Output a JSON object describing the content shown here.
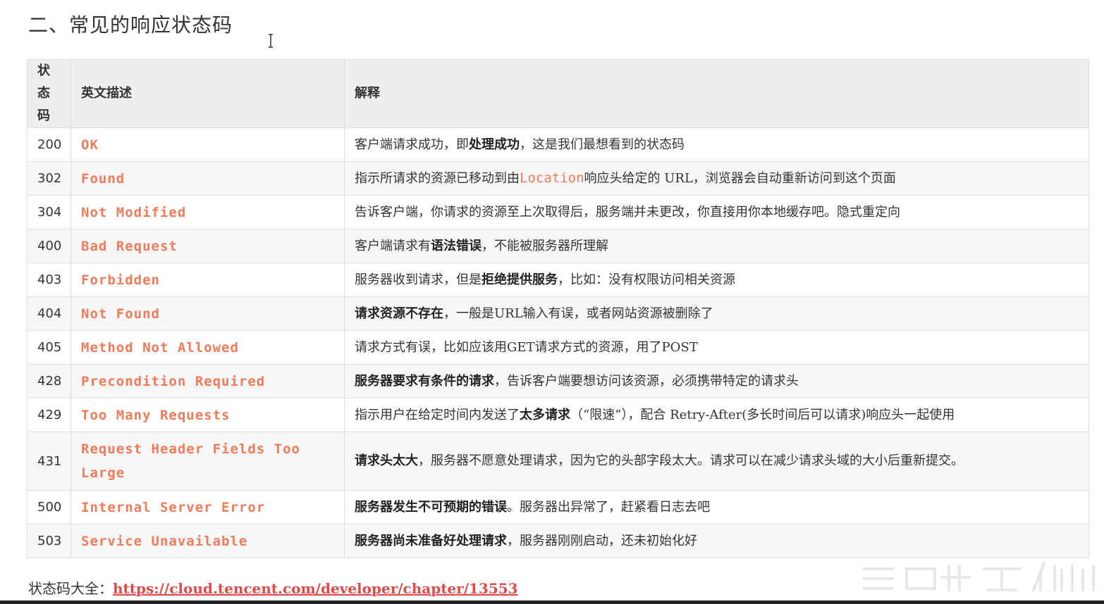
{
  "title": "二、常见的响应状态码",
  "table": {
    "headers": [
      "状态码",
      "英文描述",
      "解释"
    ],
    "rows": [
      {
        "code": "200",
        "name": "OK",
        "desc": [
          {
            "t": "客户端请求成功，即"
          },
          {
            "t": "处理成功",
            "b": true
          },
          {
            "t": "，这是我们最想看到的状态码"
          }
        ]
      },
      {
        "code": "302",
        "name": "Found",
        "desc": [
          {
            "t": "指示所请求的资源已移动到由"
          },
          {
            "t": "Location",
            "c": true
          },
          {
            "t": "响应头给定的 URL，浏览器会自动重新访问到这个页面"
          }
        ]
      },
      {
        "code": "304",
        "name": "Not Modified",
        "desc": [
          {
            "t": "告诉客户端，你请求的资源至上次取得后，服务端并未更改，你直接用你本地缓存吧。隐式重定向"
          }
        ]
      },
      {
        "code": "400",
        "name": "Bad Request",
        "desc": [
          {
            "t": "客户端请求有"
          },
          {
            "t": "语法错误",
            "b": true
          },
          {
            "t": "，不能被服务器所理解"
          }
        ]
      },
      {
        "code": "403",
        "name": "Forbidden",
        "desc": [
          {
            "t": "服务器收到请求，但是"
          },
          {
            "t": "拒绝提供服务",
            "b": true
          },
          {
            "t": "，比如：没有权限访问相关资源"
          }
        ]
      },
      {
        "code": "404",
        "name": "Not Found",
        "desc": [
          {
            "t": "请求资源不存在",
            "b": true
          },
          {
            "t": "，一般是URL输入有误，或者网站资源被删除了"
          }
        ]
      },
      {
        "code": "405",
        "name": "Method Not Allowed",
        "desc": [
          {
            "t": "请求方式有误，比如应该用GET请求方式的资源，用了POST"
          }
        ]
      },
      {
        "code": "428",
        "name": "Precondition Required",
        "desc": [
          {
            "t": "服务器要求有条件的请求",
            "b": true
          },
          {
            "t": "，告诉客户端要想访问该资源，必须携带特定的请求头"
          }
        ]
      },
      {
        "code": "429",
        "name": "Too Many Requests",
        "desc": [
          {
            "t": "指示用户在给定时间内发送了"
          },
          {
            "t": "太多请求",
            "b": true
          },
          {
            "t": "（“限速”），配合 Retry-After(多长时间后可以请求)响应头一起使用"
          }
        ]
      },
      {
        "code": "431",
        "name": "Request Header Fields Too Large",
        "desc": [
          {
            "t": "请求头太大",
            "b": true
          },
          {
            "t": "，服务器不愿意处理请求，因为它的头部字段太大。请求可以在减少请求头域的大小后重新提交。"
          }
        ]
      },
      {
        "code": "500",
        "name": "Internal Server Error",
        "desc": [
          {
            "t": "服务器发生不可预期的错误",
            "b": true
          },
          {
            "t": "。服务器出异常了，赶紧看日志去吧"
          }
        ]
      },
      {
        "code": "503",
        "name": "Service Unavailable",
        "desc": [
          {
            "t": "服务器尚未准备好处理请求",
            "b": true
          },
          {
            "t": "，服务器刚刚启动，还未初始化好"
          }
        ]
      }
    ]
  },
  "footer": {
    "label": "状态码大全：",
    "link": "https://cloud.tencent.com/developer/chapter/13553"
  },
  "colors": {
    "accent": "#ef7b5b",
    "link": "#e24a4a",
    "header_bg": "#eeeeee"
  }
}
